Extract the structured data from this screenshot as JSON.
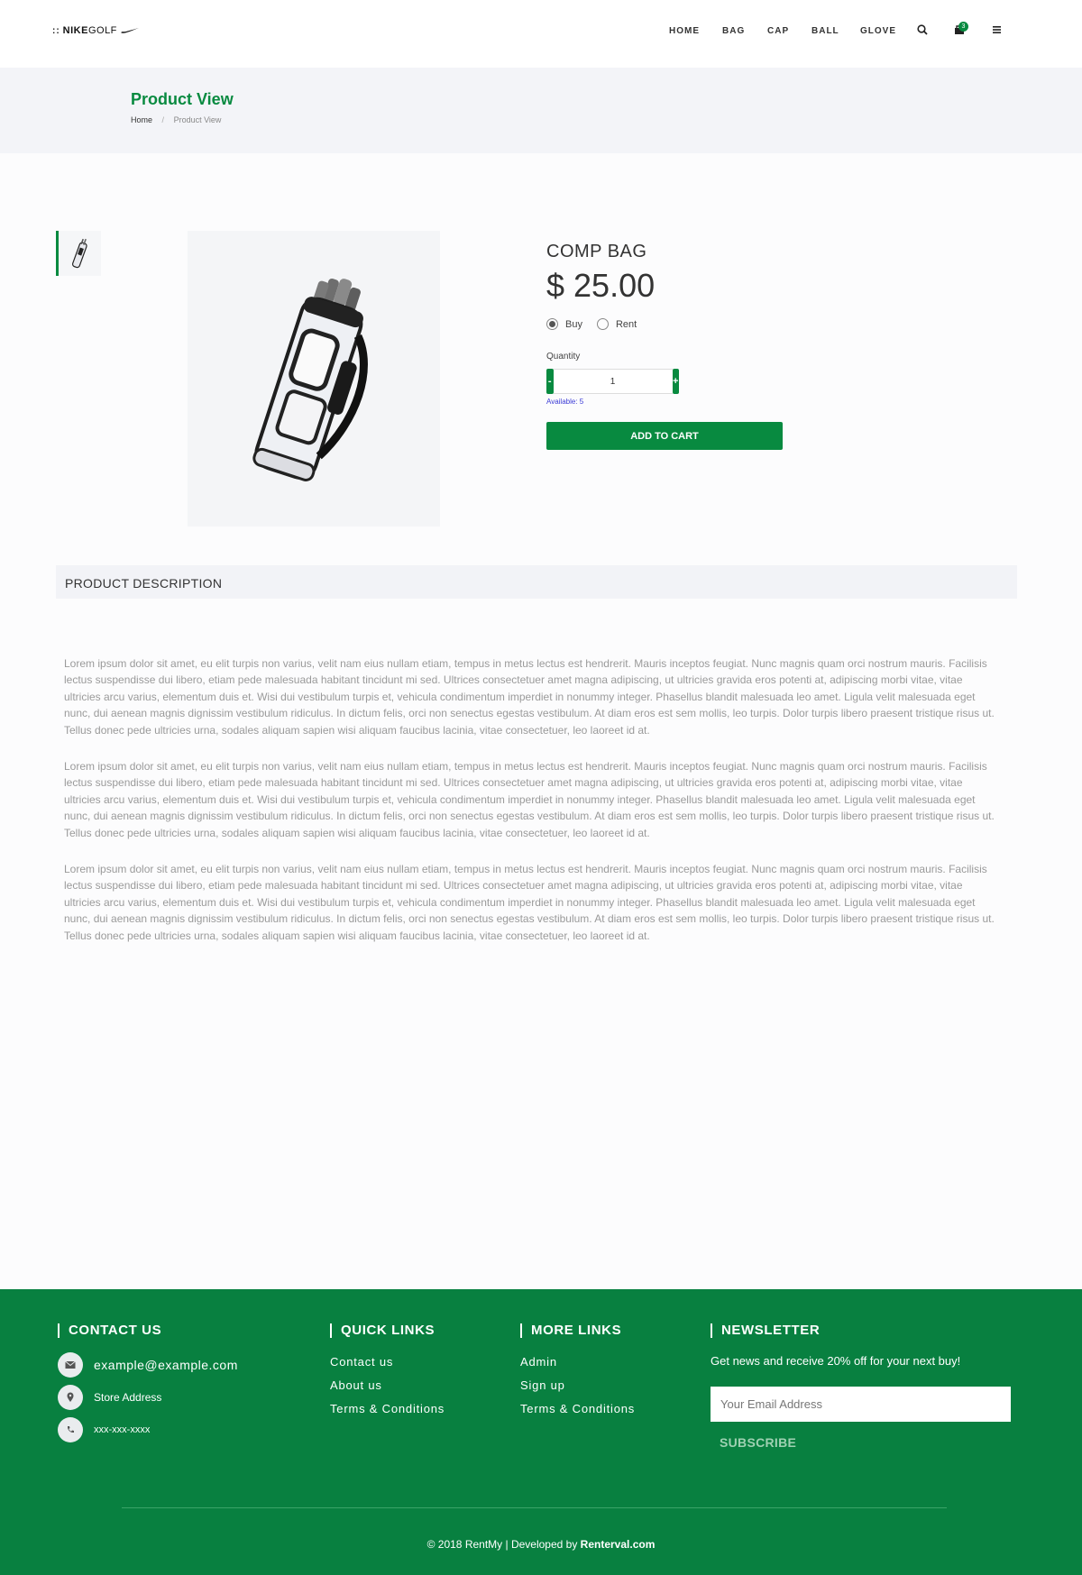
{
  "brand": {
    "logo_prefix": "::",
    "logo_bold": "NIKE",
    "logo_light": "GOLF"
  },
  "nav": {
    "items": [
      "HOME",
      "BAG",
      "CAP",
      "BALL",
      "GLOVE"
    ],
    "cart_count": "3"
  },
  "page": {
    "title": "Product View",
    "breadcrumb_home": "Home",
    "breadcrumb_sep": "/",
    "breadcrumb_current": "Product View"
  },
  "product": {
    "name": "COMP BAG",
    "price": "$ 25.00",
    "option_buy": "Buy",
    "option_rent": "Rent",
    "selected_option": "Buy",
    "quantity_label": "Quantity",
    "quantity_value": "1",
    "minus": "-",
    "plus": "+",
    "available": "Available: 5",
    "add_to_cart": "ADD TO CART"
  },
  "description": {
    "title": "PRODUCT DESCRIPTION",
    "paragraphs": [
      "Lorem ipsum dolor sit amet, eu elit turpis non varius, velit nam eius nullam etiam, tempus in metus lectus est hendrerit. Mauris inceptos feugiat. Nunc magnis quam orci nostrum mauris. Facilisis lectus suspendisse dui libero, etiam pede malesuada habitant tincidunt mi sed. Ultrices consectetuer amet magna adipiscing, ut ultricies gravida eros potenti at, adipiscing morbi vitae, vitae ultricies arcu varius, elementum duis et. Wisi dui vestibulum turpis et, vehicula condimentum imperdiet in nonummy integer. Phasellus blandit malesuada leo amet. Ligula velit malesuada eget nunc, dui aenean magnis dignissim vestibulum ridiculus. In dictum felis, orci non senectus egestas vestibulum. At diam eros est sem mollis, leo turpis. Dolor turpis libero praesent tristique risus ut. Tellus donec pede ultricies urna, sodales aliquam sapien wisi aliquam faucibus lacinia, vitae consectetuer, leo laoreet id at.",
      "Lorem ipsum dolor sit amet, eu elit turpis non varius, velit nam eius nullam etiam, tempus in metus lectus est hendrerit. Mauris inceptos feugiat. Nunc magnis quam orci nostrum mauris. Facilisis lectus suspendisse dui libero, etiam pede malesuada habitant tincidunt mi sed. Ultrices consectetuer amet magna adipiscing, ut ultricies gravida eros potenti at, adipiscing morbi vitae, vitae ultricies arcu varius, elementum duis et. Wisi dui vestibulum turpis et, vehicula condimentum imperdiet in nonummy integer. Phasellus blandit malesuada leo amet. Ligula velit malesuada eget nunc, dui aenean magnis dignissim vestibulum ridiculus. In dictum felis, orci non senectus egestas vestibulum. At diam eros est sem mollis, leo turpis. Dolor turpis libero praesent tristique risus ut. Tellus donec pede ultricies urna, sodales aliquam sapien wisi aliquam faucibus lacinia, vitae consectetuer, leo laoreet id at.",
      "Lorem ipsum dolor sit amet, eu elit turpis non varius, velit nam eius nullam etiam, tempus in metus lectus est hendrerit. Mauris inceptos feugiat. Nunc magnis quam orci nostrum mauris. Facilisis lectus suspendisse dui libero, etiam pede malesuada habitant tincidunt mi sed. Ultrices consectetuer amet magna adipiscing, ut ultricies gravida eros potenti at, adipiscing morbi vitae, vitae ultricies arcu varius, elementum duis et. Wisi dui vestibulum turpis et, vehicula condimentum imperdiet in nonummy integer. Phasellus blandit malesuada leo amet. Ligula velit malesuada eget nunc, dui aenean magnis dignissim vestibulum ridiculus. In dictum felis, orci non senectus egestas vestibulum. At diam eros est sem mollis, leo turpis. Dolor turpis libero praesent tristique risus ut. Tellus donec pede ultricies urna, sodales aliquam sapien wisi aliquam faucibus lacinia, vitae consectetuer, leo laoreet id at."
    ]
  },
  "footer": {
    "contact": {
      "title": "CONTACT US",
      "email": "example@example.com",
      "address": "Store Address",
      "phone": "xxx-xxx-xxxx"
    },
    "quick_links": {
      "title": "QUICK LINKS",
      "items": [
        "Contact us",
        "About us",
        "Terms & Conditions"
      ]
    },
    "more_links": {
      "title": "MORE LINKS",
      "items": [
        "Admin",
        "Sign up",
        "Terms & Conditions"
      ]
    },
    "newsletter": {
      "title": "NEWSLETTER",
      "text": "Get news and receive 20% off for your next buy!",
      "placeholder": "Your Email Address",
      "button": "SUBSCRIBE"
    },
    "copyright_prefix": "© 2018 RentMy | Developed by ",
    "copyright_link": "Renterval.com"
  },
  "colors": {
    "brand_green": "#088a40",
    "footer_green": "#088040",
    "band_gray": "#f3f4f8",
    "available_blue": "#3b3bd6"
  },
  "icons": {
    "search": "search-icon",
    "cart": "cart-icon",
    "menu": "menu-icon",
    "email": "envelope-icon",
    "address": "map-pin-icon",
    "phone": "phone-icon"
  }
}
